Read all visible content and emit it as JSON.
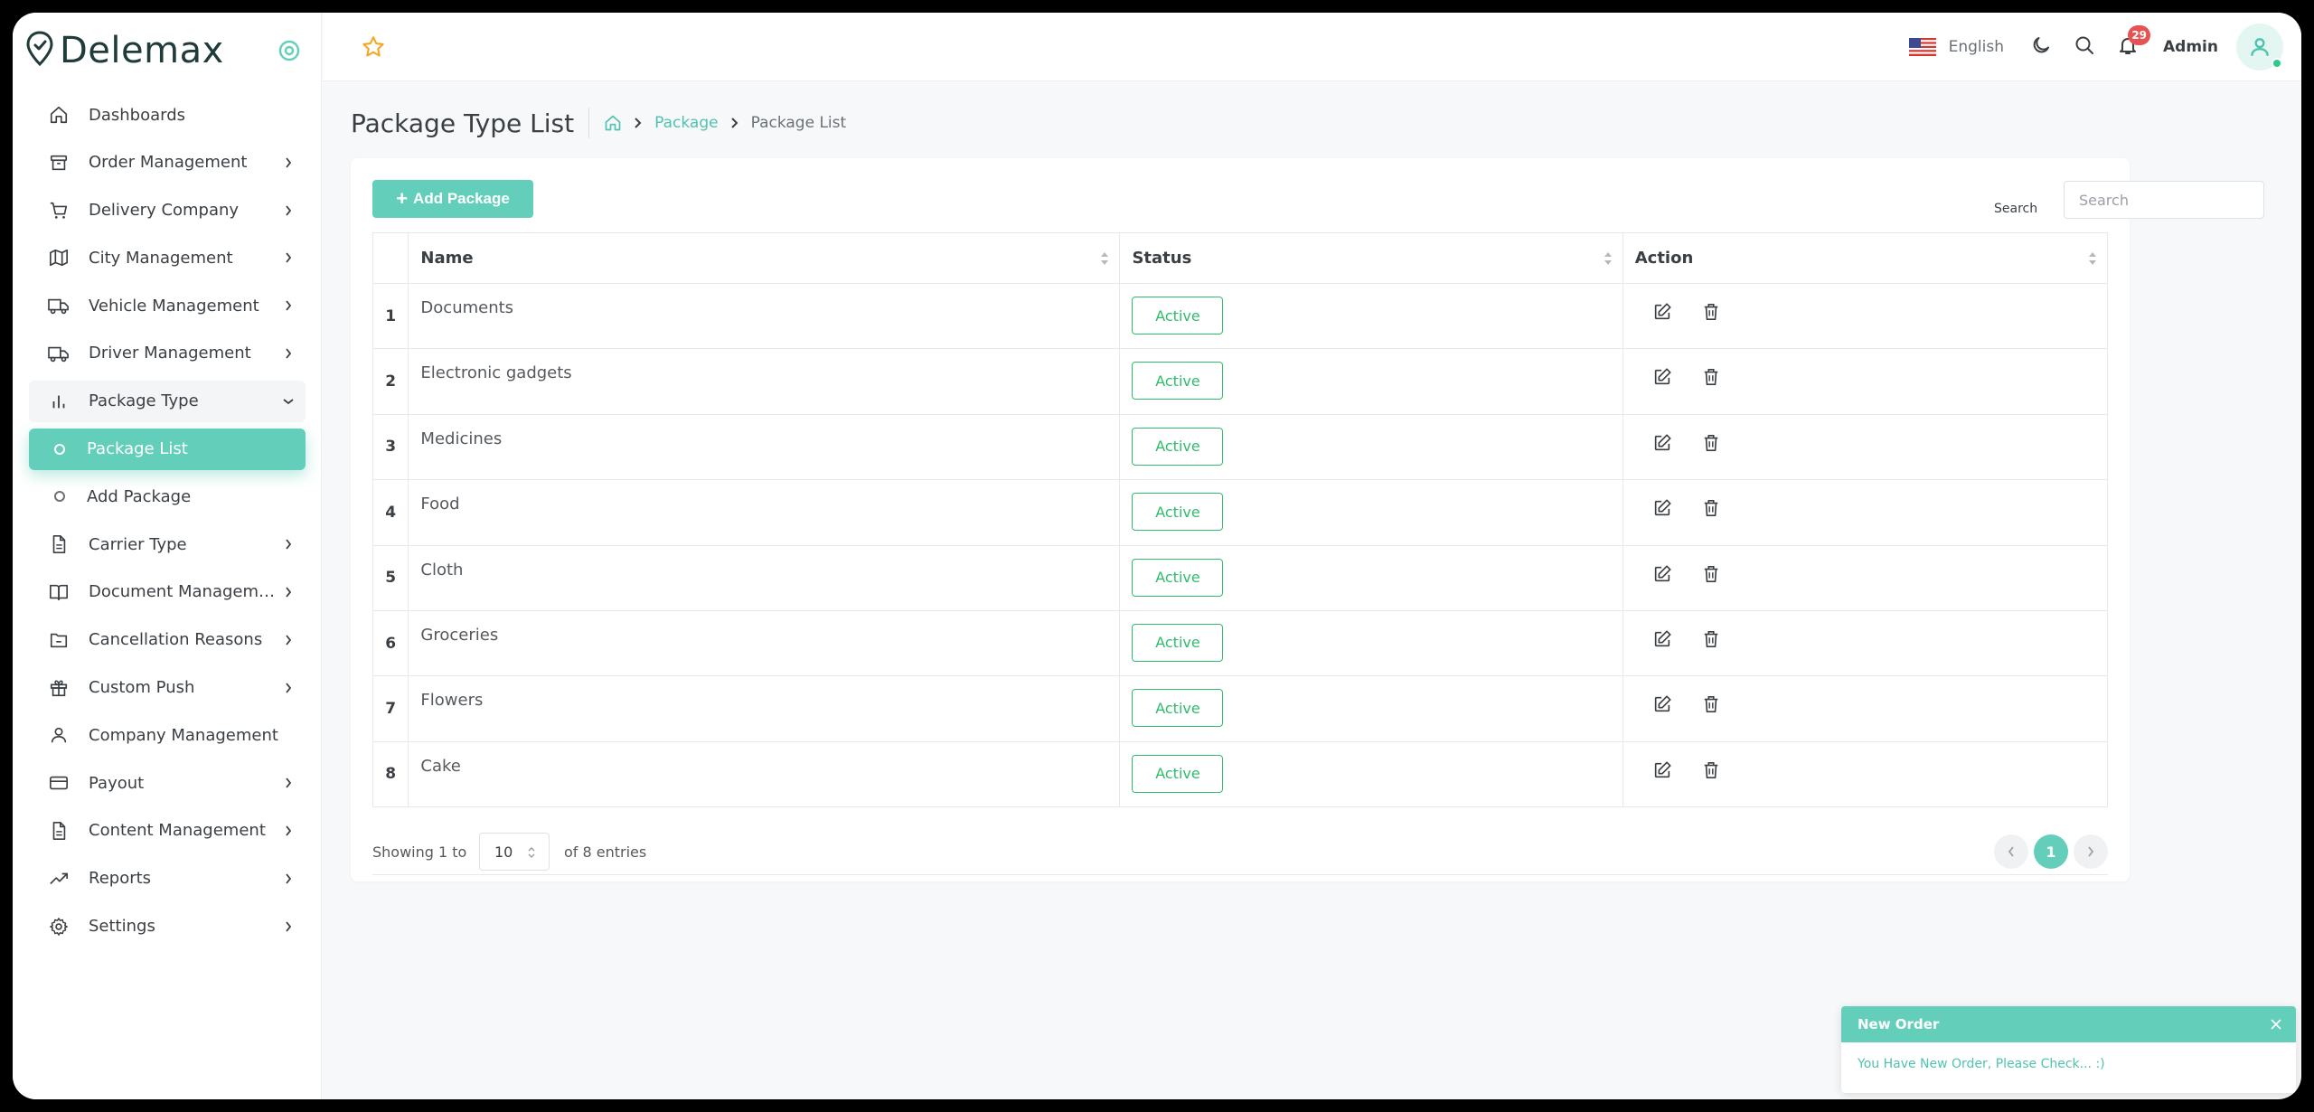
{
  "brand": {
    "name": "Delemax"
  },
  "sidebar": {
    "items": [
      {
        "label": "Dashboards",
        "icon": "home-icon",
        "chevron": false
      },
      {
        "label": "Order Management",
        "icon": "archive-box-icon",
        "chevron": true
      },
      {
        "label": "Delivery Company",
        "icon": "cart-icon",
        "chevron": true
      },
      {
        "label": "City Management",
        "icon": "map-icon",
        "chevron": true
      },
      {
        "label": "Vehicle Management",
        "icon": "truck-icon",
        "chevron": true
      },
      {
        "label": "Driver Management",
        "icon": "truck-icon",
        "chevron": true
      },
      {
        "label": "Package Type",
        "icon": "bar-chart-icon",
        "chevron": "down",
        "open": true
      },
      {
        "label": "Package List",
        "sub": true,
        "active": true
      },
      {
        "label": "Add Package",
        "sub": true
      },
      {
        "label": "Carrier Type",
        "icon": "document-icon",
        "chevron": true
      },
      {
        "label": "Document Management",
        "icon": "book-icon",
        "chevron": true
      },
      {
        "label": "Cancellation Reasons",
        "icon": "folder-minus-icon",
        "chevron": true
      },
      {
        "label": "Custom Push",
        "icon": "gift-icon",
        "chevron": true
      },
      {
        "label": "Company Management",
        "icon": "user-icon",
        "chevron": false
      },
      {
        "label": "Payout",
        "icon": "credit-card-icon",
        "chevron": true
      },
      {
        "label": "Content Management",
        "icon": "document-icon",
        "chevron": true
      },
      {
        "label": "Reports",
        "icon": "trending-up-icon",
        "chevron": true
      },
      {
        "label": "Settings",
        "icon": "gear-icon",
        "chevron": true
      }
    ]
  },
  "header": {
    "language": "English",
    "notifications_count": "29",
    "user_name": "Admin"
  },
  "page": {
    "title": "Package Type List",
    "breadcrumb": {
      "parent": "Package",
      "current": "Package List"
    }
  },
  "toolbar": {
    "add_label": "Add Package",
    "search_label": "Search",
    "search_placeholder": "Search"
  },
  "table": {
    "columns": [
      "Name",
      "Status",
      "Action"
    ],
    "rows": [
      {
        "index": "1",
        "name": "Documents",
        "status": "Active"
      },
      {
        "index": "2",
        "name": "Electronic gadgets",
        "status": "Active"
      },
      {
        "index": "3",
        "name": "Medicines",
        "status": "Active"
      },
      {
        "index": "4",
        "name": "Food",
        "status": "Active"
      },
      {
        "index": "5",
        "name": "Cloth",
        "status": "Active"
      },
      {
        "index": "6",
        "name": "Groceries",
        "status": "Active"
      },
      {
        "index": "7",
        "name": "Flowers",
        "status": "Active"
      },
      {
        "index": "8",
        "name": "Cake",
        "status": "Active"
      }
    ]
  },
  "footer": {
    "showing_prefix": "Showing 1 to",
    "page_size": "10",
    "showing_suffix": "of 8 entries",
    "current_page": "1"
  },
  "toast": {
    "title": "New Order",
    "message": "You Have New Order, Please Check... :)"
  },
  "colors": {
    "accent": "#63cfbb",
    "status_active": "#2ebd6b",
    "badge": "#e55353",
    "brand_text": "#1f3b3a"
  }
}
